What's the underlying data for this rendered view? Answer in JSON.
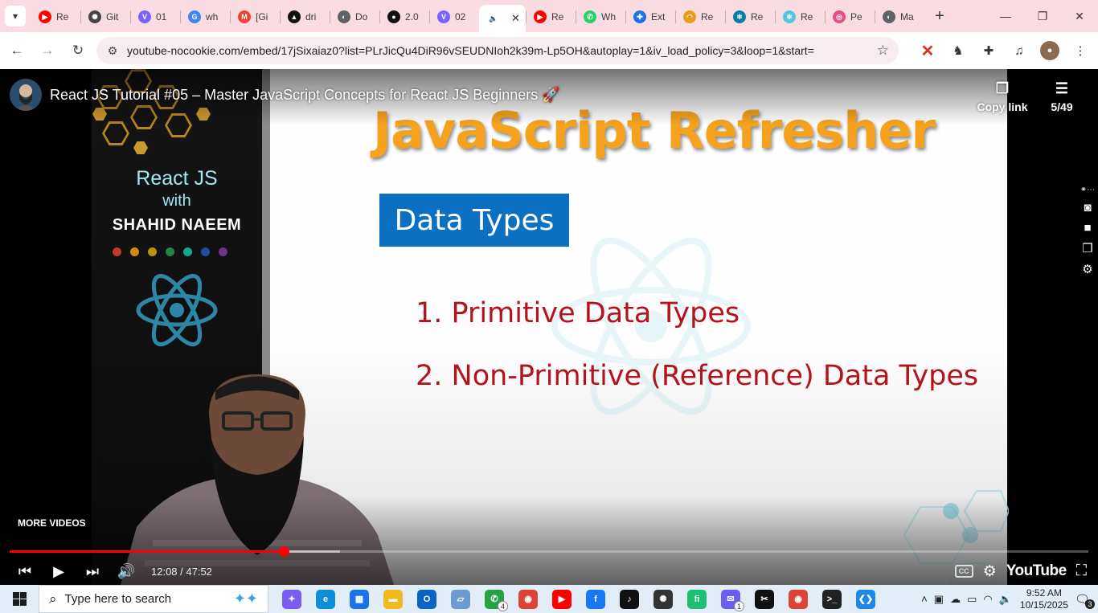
{
  "browser": {
    "tabs": [
      {
        "label": "Re",
        "favicon": "youtube-icon",
        "color": "#ff0000",
        "glyph": "▶"
      },
      {
        "label": "Git",
        "favicon": "openai-icon",
        "color": "#444444",
        "glyph": "✺"
      },
      {
        "label": "01",
        "favicon": "vite-icon",
        "color": "#7b61ff",
        "glyph": "V"
      },
      {
        "label": "wh",
        "favicon": "google-icon",
        "color": "#4285f4",
        "glyph": "G"
      },
      {
        "label": "[Gi",
        "favicon": "gmail-icon",
        "color": "#ea4335",
        "glyph": "M"
      },
      {
        "label": "dri",
        "favicon": "drive-icon",
        "color": "#111111",
        "glyph": "▲"
      },
      {
        "label": "Do",
        "favicon": "globe-icon",
        "color": "#5f6368",
        "glyph": "◐"
      },
      {
        "label": "2.0",
        "favicon": "github-icon",
        "color": "#111111",
        "glyph": "●"
      },
      {
        "label": "02",
        "favicon": "vite-icon",
        "color": "#7b61ff",
        "glyph": "V"
      },
      {
        "label": "",
        "favicon": "audio-playing-icon",
        "color": "#5f6368",
        "glyph": "🔈",
        "active": true
      },
      {
        "label": "Re",
        "favicon": "youtube-icon",
        "color": "#ff0000",
        "glyph": "▶"
      },
      {
        "label": "Wh",
        "favicon": "whatsapp-icon",
        "color": "#25d366",
        "glyph": "✆"
      },
      {
        "label": "Ext",
        "favicon": "puzzle-icon",
        "color": "#1a73e8",
        "glyph": "✚"
      },
      {
        "label": "Re",
        "favicon": "rainbow-icon",
        "color": "#e89b1a",
        "glyph": "◠"
      },
      {
        "label": "Re",
        "favicon": "react-book-icon",
        "color": "#087ea4",
        "glyph": "⚛"
      },
      {
        "label": "Re",
        "favicon": "react-icon",
        "color": "#58c4dc",
        "glyph": "⚛"
      },
      {
        "label": "Pe",
        "favicon": "dribbble-icon",
        "color": "#ea4c89",
        "glyph": "◎"
      },
      {
        "label": "Ma",
        "favicon": "globe-icon",
        "color": "#5f6368",
        "glyph": "◐"
      }
    ],
    "url": "youtube-nocookie.com/embed/17jSixaiaz0?list=PLrJicQu4DiR96vSEUDNIoh2k39m-Lp5OH&autoplay=1&iv_load_policy=3&loop=1&start="
  },
  "video": {
    "title": "React JS Tutorial #05 – Master JavaScript Concepts for React JS Beginners 🚀",
    "copy_link_label": "Copy link",
    "playlist_position": "5/49",
    "more_videos_label": "MORE VIDEOS",
    "time_display": "12:08 / 47:52",
    "played_fraction": 0.254,
    "buffered_fraction": 0.306,
    "youtube_label": "YouTube",
    "slide": {
      "heading": "JavaScript Refresher",
      "subheading": "Data Types",
      "items": [
        "1. Primitive Data Types",
        "2. Non-Primitive (Reference) Data Types"
      ],
      "left_panel": {
        "line1": "React JS",
        "line2": "with",
        "line3": "SHAHID NAEEM"
      },
      "dot_colors": [
        "#c0392b",
        "#d68910",
        "#b7950b",
        "#1e8449",
        "#17a589",
        "#1f4e9c",
        "#6c3483"
      ]
    }
  },
  "taskbar": {
    "search_placeholder": "Type here to search",
    "apps": [
      {
        "name": "copilot-icon",
        "color": "#7a5cf0",
        "glyph": "✦"
      },
      {
        "name": "edge-icon",
        "color": "#0c8ed8",
        "glyph": "e"
      },
      {
        "name": "store-icon",
        "color": "#1a73e8",
        "glyph": "▦"
      },
      {
        "name": "file-explorer-icon",
        "color": "#f2b81f",
        "glyph": "▬"
      },
      {
        "name": "outlook-icon",
        "color": "#0a64c8",
        "glyph": "O"
      },
      {
        "name": "network-share-icon",
        "color": "#6b9bd1",
        "glyph": "▱"
      },
      {
        "name": "whatsapp-icon",
        "color": "#25a244",
        "glyph": "✆",
        "badge": "4"
      },
      {
        "name": "chrome-icon",
        "color": "#db4437",
        "glyph": "◉"
      },
      {
        "name": "youtube-icon",
        "color": "#ff0000",
        "glyph": "▶"
      },
      {
        "name": "facebook-icon",
        "color": "#1877f2",
        "glyph": "f"
      },
      {
        "name": "tiktok-icon",
        "color": "#111111",
        "glyph": "♪"
      },
      {
        "name": "chatgpt-icon",
        "color": "#333333",
        "glyph": "✺"
      },
      {
        "name": "fiverr-icon",
        "color": "#1dbf73",
        "glyph": "fi"
      },
      {
        "name": "messenger-icon",
        "color": "#6a5df0",
        "glyph": "✉",
        "badge": "1"
      },
      {
        "name": "capcut-icon",
        "color": "#111111",
        "glyph": "✂"
      },
      {
        "name": "chrome-profile-icon",
        "color": "#db4437",
        "glyph": "◉"
      },
      {
        "name": "terminal-icon",
        "color": "#222222",
        "glyph": ">_"
      },
      {
        "name": "vscode-icon",
        "color": "#1e88e5",
        "glyph": "❮❯"
      }
    ],
    "time": "9:52 AM",
    "date": "10/15/2025",
    "notification_count": "3"
  }
}
